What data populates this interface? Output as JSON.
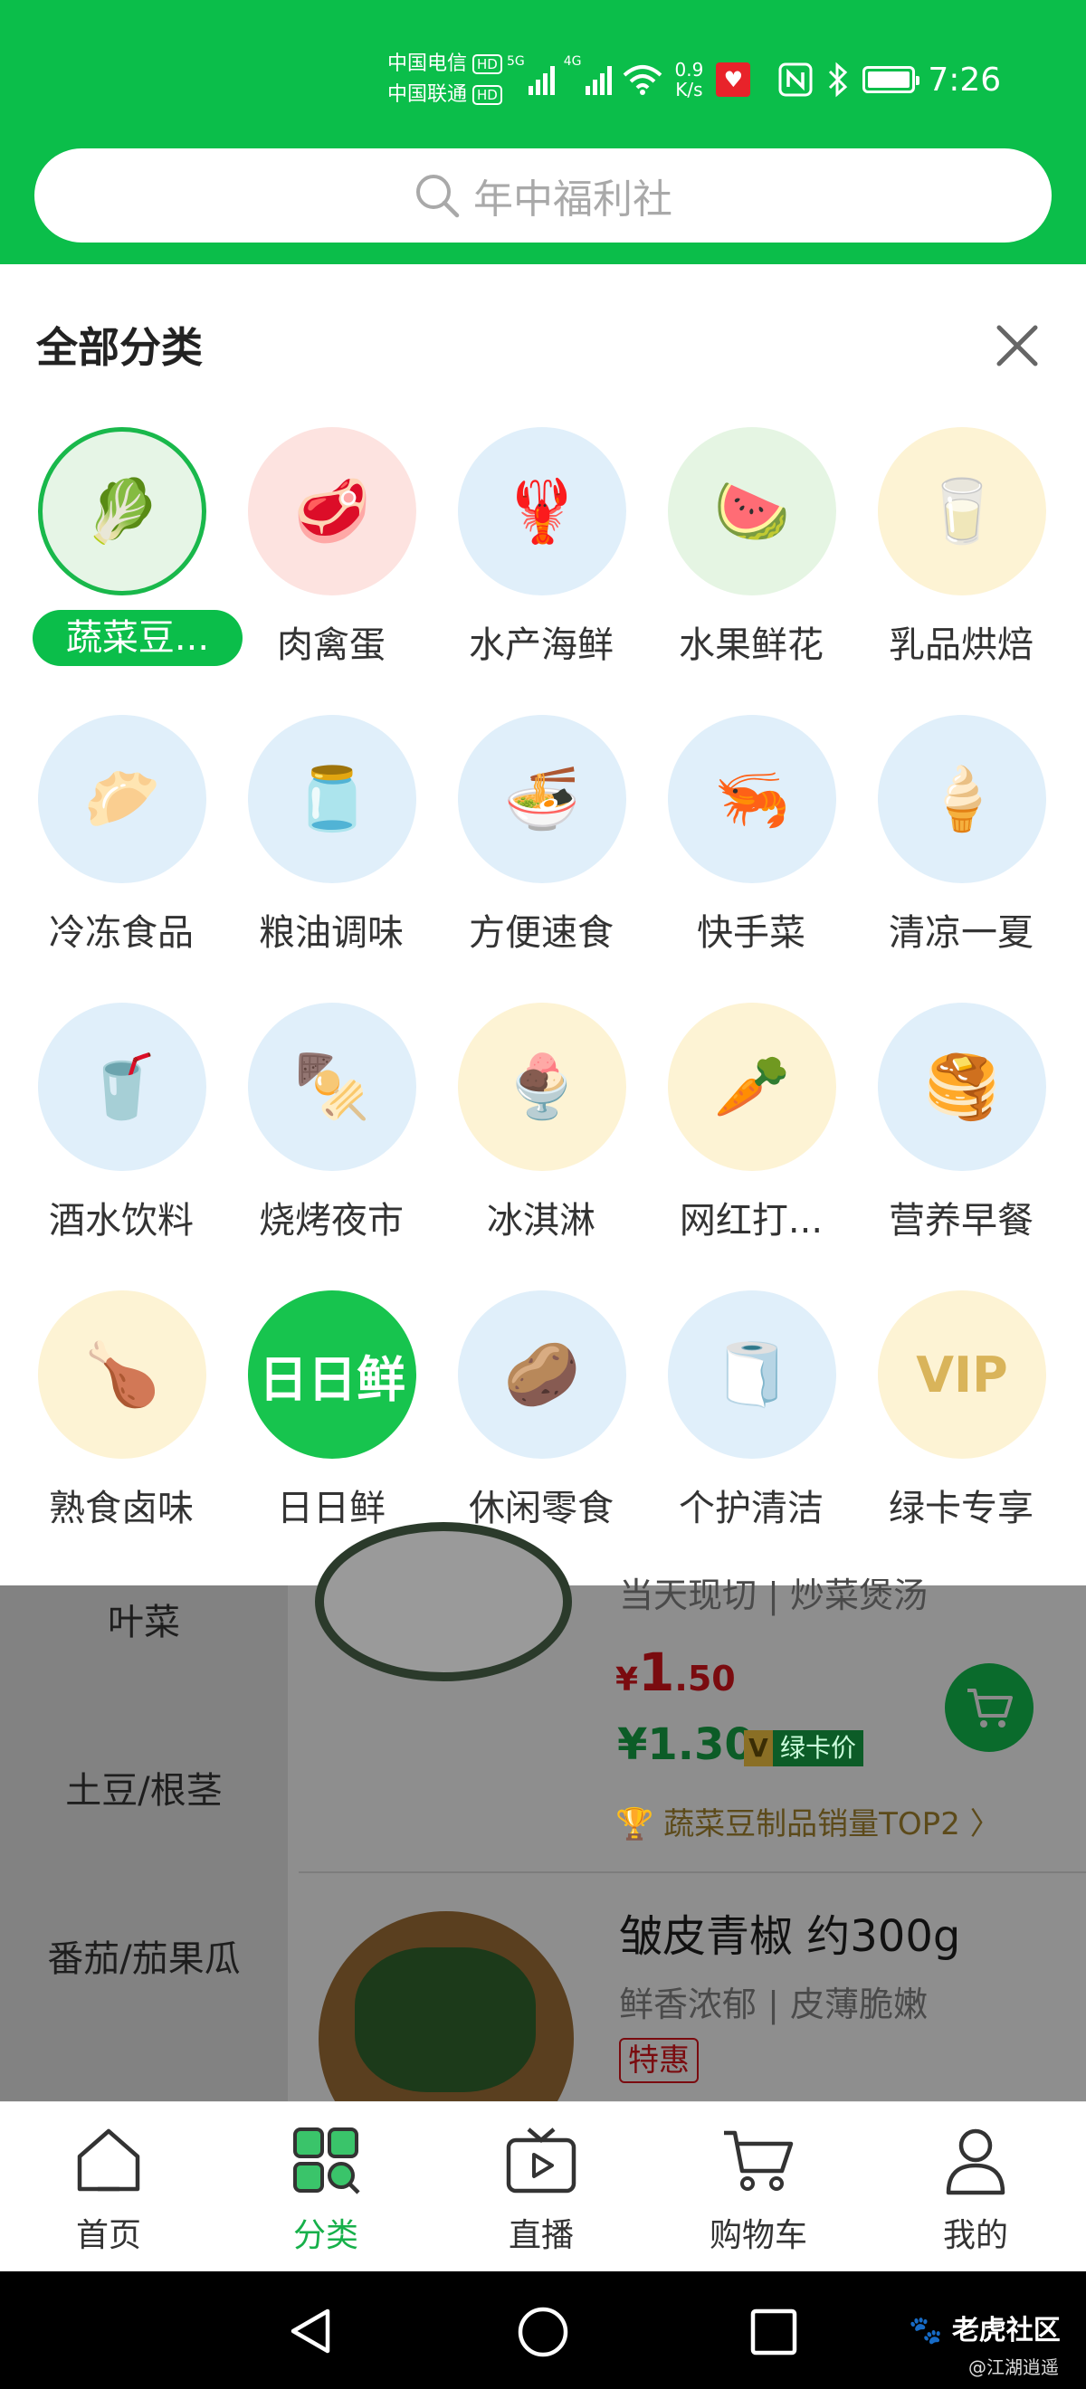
{
  "status_bar": {
    "carrier1": "中国电信",
    "carrier2": "中国联通",
    "hd": "HD",
    "sig1_label": "5G",
    "sig2_label": "4G",
    "speed_value": "0.9",
    "speed_unit": "K/s",
    "time": "7:26"
  },
  "search": {
    "placeholder": "年中福利社"
  },
  "panel": {
    "title": "全部分类",
    "categories": [
      {
        "label": "蔬菜豆...",
        "selected": true,
        "bg": "#e6f5e6",
        "glyph": "🥬"
      },
      {
        "label": "肉禽蛋",
        "bg": "#fde3e0",
        "glyph": "🥩"
      },
      {
        "label": "水产海鲜",
        "bg": "#e0effa",
        "glyph": "🦞"
      },
      {
        "label": "水果鲜花",
        "bg": "#e5f5e3",
        "glyph": "🍉"
      },
      {
        "label": "乳品烘焙",
        "bg": "#fdf3d4",
        "glyph": "🥛"
      },
      {
        "label": "冷冻食品",
        "bg": "#e0effa",
        "glyph": "🥟"
      },
      {
        "label": "粮油调味",
        "bg": "#e0effa",
        "glyph": "🫙"
      },
      {
        "label": "方便速食",
        "bg": "#e0effa",
        "glyph": "🍜"
      },
      {
        "label": "快手菜",
        "bg": "#e0effa",
        "glyph": "🦐"
      },
      {
        "label": "清凉一夏",
        "bg": "#e0effa",
        "glyph": "🍦"
      },
      {
        "label": "酒水饮料",
        "bg": "#e0effa",
        "glyph": "🥤"
      },
      {
        "label": "烧烤夜市",
        "bg": "#e0effa",
        "glyph": "🍢"
      },
      {
        "label": "冰淇淋",
        "bg": "#fdf3d4",
        "glyph": "🍨"
      },
      {
        "label": "网红打...",
        "bg": "#fdf3d4",
        "glyph": "🥕"
      },
      {
        "label": "营养早餐",
        "bg": "#e0effa",
        "glyph": "🥞"
      },
      {
        "label": "熟食卤味",
        "bg": "#fdf3d4",
        "glyph": "🍗"
      },
      {
        "label": "日日鲜",
        "bg": "#17c44e",
        "glyph": "日日鲜",
        "text_color": "#ffffff"
      },
      {
        "label": "休闲零食",
        "bg": "#e0effa",
        "glyph": "🥔"
      },
      {
        "label": "个护清洁",
        "bg": "#e0effa",
        "glyph": "🧻"
      },
      {
        "label": "绿卡专享",
        "bg": "#fdf3d4",
        "glyph": "VIP",
        "text_color": "#d9b45a"
      }
    ]
  },
  "list": {
    "side_items": [
      "叶菜",
      "土豆/根茎",
      "番茄/茄果瓜"
    ],
    "p1_sub": "当天现切 | 炒菜煲汤",
    "p1_price_symbol": "¥",
    "p1_price_int": "1",
    "p1_price_dec": ".50",
    "p1_vip_price": "¥1.30",
    "p1_vip_badge": "V",
    "p1_vip_tag": "绿卡价",
    "p1_rank": "蔬菜豆制品销量TOP2",
    "p2_name": "皱皮青椒 约300g",
    "p2_sub": "鲜香浓郁 | 皮薄脆嫩",
    "p2_tag": "特惠"
  },
  "tabbar": {
    "tabs": [
      {
        "label": "首页",
        "icon": "home-icon"
      },
      {
        "label": "分类",
        "icon": "category-icon",
        "active": true
      },
      {
        "label": "直播",
        "icon": "live-tv-icon"
      },
      {
        "label": "购物车",
        "icon": "cart-icon"
      },
      {
        "label": "我的",
        "icon": "profile-icon"
      }
    ]
  },
  "watermark": {
    "main": "老虎社区",
    "sub": "@江湖逍遥"
  },
  "colors": {
    "brand": "#0bbe4a",
    "price_red": "#c0161c"
  }
}
